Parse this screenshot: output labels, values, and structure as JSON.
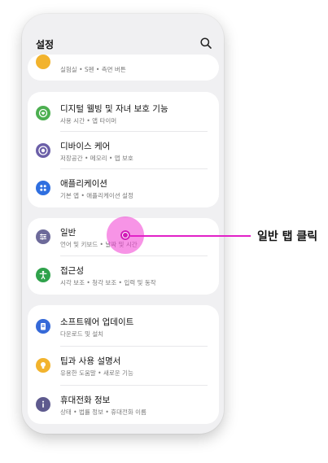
{
  "header": {
    "title": "설정",
    "search_icon": "search-icon"
  },
  "top_card": {
    "partial_title": "",
    "subtitle": "실험실 • S펜 • 측면 버튼",
    "icon_color": "#f2b32d"
  },
  "card1": [
    {
      "title": "디지털 웰빙 및 자녀 보호 기능",
      "subtitle": "사용 시간 • 앱 타이머",
      "icon": "heart-circle-icon",
      "color": "#4caf50"
    },
    {
      "title": "디바이스 케어",
      "subtitle": "저장공간 • 메모리 • 앱 보호",
      "icon": "device-care-icon",
      "color": "#6b5fa8"
    },
    {
      "title": "애플리케이션",
      "subtitle": "기본 앱 • 애플리케이션 설정",
      "icon": "apps-grid-icon",
      "color": "#2f6fe0"
    }
  ],
  "card2": [
    {
      "title": "일반",
      "subtitle": "언어 및 키보드 • 날짜 및 시간",
      "icon": "sliders-icon",
      "color": "#6d6a9a"
    },
    {
      "title": "접근성",
      "subtitle": "시각 보조 • 청각 보조 • 입력 및 동작",
      "icon": "accessibility-icon",
      "color": "#2fa24b"
    }
  ],
  "card3": [
    {
      "title": "소프트웨어 업데이트",
      "subtitle": "다운로드 및 설치",
      "icon": "update-icon",
      "color": "#3569d8"
    },
    {
      "title": "팁과 사용 설명서",
      "subtitle": "유용한 도움말 • 새로운 기능",
      "icon": "bulb-icon",
      "color": "#f2b32d"
    },
    {
      "title": "휴대전화 정보",
      "subtitle": "상태 • 법률 정보 • 휴대전화 이름",
      "icon": "info-icon",
      "color": "#5e5a8e"
    }
  ],
  "annotation": {
    "label": "일반 탭 클릭",
    "color": "#e221c8"
  }
}
